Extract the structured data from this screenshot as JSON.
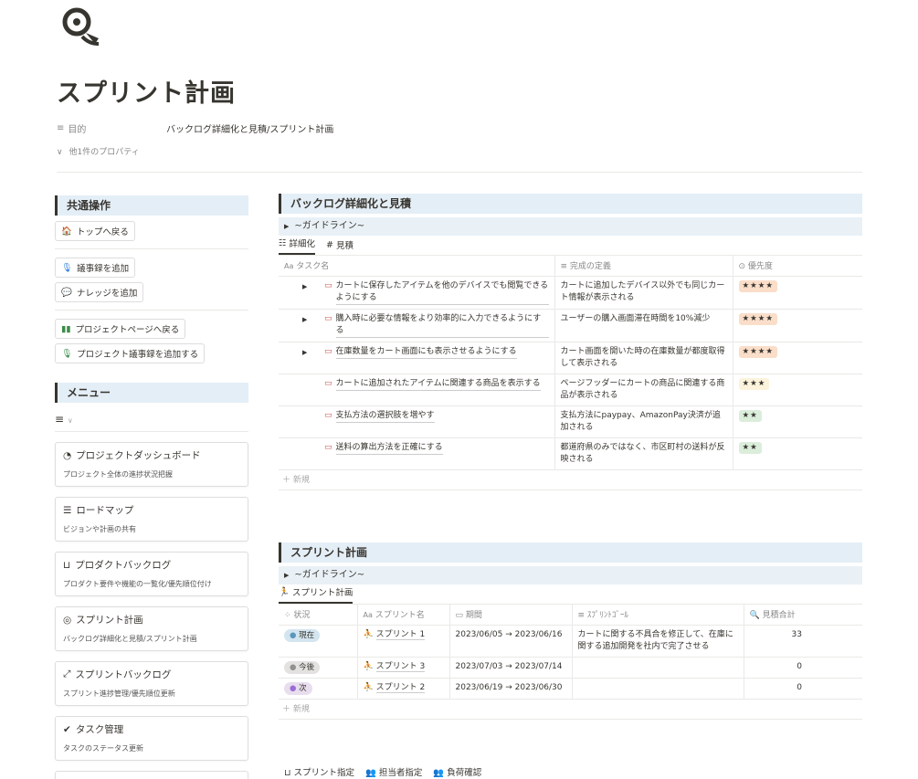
{
  "page": {
    "title": "スプリント計画",
    "prop_label": "目的",
    "prop_value": "バックログ詳細化と見積/スプリント計画",
    "more_props": "他1件のプロパティ"
  },
  "sidebar": {
    "common_title": "共通操作",
    "buttons": [
      "トップへ戻る",
      "議事録を追加",
      "ナレッジを追加",
      "プロジェクトページへ戻る",
      "プロジェクト議事録を追加する"
    ],
    "menu_title": "メニュー",
    "cards": [
      {
        "title": "プロジェクトダッシュボード",
        "desc": "プロジェクト全体の進捗状況把握"
      },
      {
        "title": "ロードマップ",
        "desc": "ビジョンや計画の共有"
      },
      {
        "title": "プロダクトバックログ",
        "desc": "プロダクト要件や機能の一覧化/優先順位付け"
      },
      {
        "title": "スプリント計画",
        "desc": "バックログ詳細化と見積/スプリント計画"
      },
      {
        "title": "スプリントバックログ",
        "desc": "スプリント進捗管理/優先順位更新"
      },
      {
        "title": "タスク管理",
        "desc": "タスクのステータス更新"
      }
    ]
  },
  "backlog": {
    "title": "バックログ詳細化と見積",
    "guideline": "~ガイドライン~",
    "tabs": [
      "詳細化",
      "見積"
    ],
    "columns": [
      "タスク名",
      "完成の定義",
      "優先度"
    ],
    "rows": [
      {
        "task": "カートに保存したアイテムを他のデバイスでも閲覧できるようにする",
        "def": "カートに追加したデバイス以外でも同じカート情報が表示される",
        "prio": "★★★★",
        "expand": true
      },
      {
        "task": "購入時に必要な情報をより効率的に入力できるようにする",
        "def": "ユーザーの購入画面滞在時間を10%減少",
        "prio": "★★★★",
        "expand": true
      },
      {
        "task": "在庫数量をカート画面にも表示させるようにする",
        "def": "カート画面を開いた時の在庫数量が都度取得して表示される",
        "prio": "★★★★",
        "expand": true
      },
      {
        "task": "カートに追加されたアイテムに関連する商品を表示する",
        "def": "ページフッダーにカートの商品に関連する商品が表示される",
        "prio": "★★★",
        "expand": false
      },
      {
        "task": "支払方法の選択肢を増やす",
        "def": "支払方法にpaypay、AmazonPay決済が追加される",
        "prio": "★★",
        "expand": false
      },
      {
        "task": "送料の算出方法を正確にする",
        "def": "都道府県のみではなく、市区町村の送料が反映される",
        "prio": "★★",
        "expand": false
      }
    ],
    "new_label": "新規"
  },
  "sprint": {
    "title": "スプリント計画",
    "guideline": "~ガイドライン~",
    "tab": "スプリント計画",
    "columns": [
      "状況",
      "スプリント名",
      "期間",
      "ｽﾌﾟﾘﾝﾄｺﾞｰﾙ",
      "見積合計"
    ],
    "rows": [
      {
        "status": "現在",
        "status_bg": "#d3e5ef",
        "status_dot": "#5b97bd",
        "name": "スプリント 1",
        "period": "2023/06/05 → 2023/06/16",
        "goal": "カートに関する不具合を修正して、在庫に関する追加開発を社内で完了させる",
        "total": "33"
      },
      {
        "status": "今後",
        "status_bg": "#e3e2e0",
        "status_dot": "#91918e",
        "name": "スプリント 3",
        "period": "2023/07/03 → 2023/07/14",
        "goal": "",
        "total": "0"
      },
      {
        "status": "次",
        "status_bg": "#e8deee",
        "status_dot": "#9a6dd7",
        "name": "スプリント 2",
        "period": "2023/06/19 → 2023/06/30",
        "goal": "",
        "total": "0"
      }
    ],
    "new_label": "新規"
  },
  "bottom_tabs": [
    "スプリント指定",
    "担当者指定",
    "負荷確認"
  ]
}
